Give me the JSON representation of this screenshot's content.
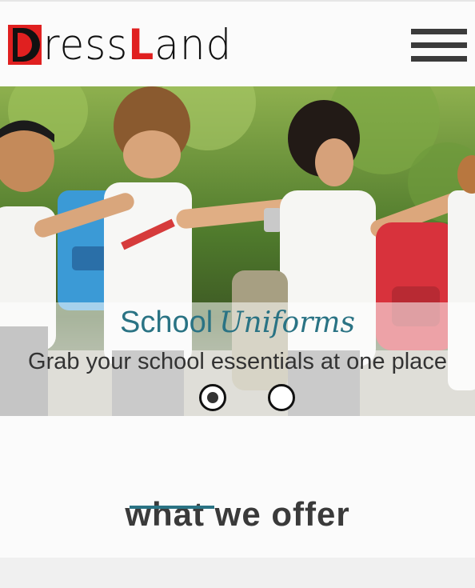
{
  "brand": {
    "logo_letter": "D",
    "logo_rest_1": "ress",
    "logo_accent": "L",
    "logo_rest_2": "and",
    "logo_full": "DressLand"
  },
  "header": {
    "menu_icon": "hamburger-icon"
  },
  "hero": {
    "title_main": "School",
    "title_script": "Uniforms",
    "subtitle": "Grab your school essentials at one place",
    "slides_total": 2,
    "active_slide": 1
  },
  "section": {
    "title": "what we offer"
  },
  "colors": {
    "accent_teal": "#2a7384",
    "logo_red": "#e02020",
    "text_dark": "#333333"
  }
}
